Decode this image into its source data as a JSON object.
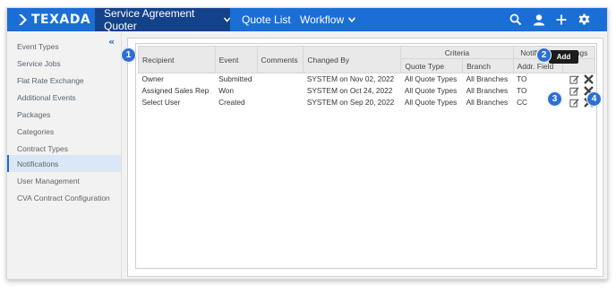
{
  "brand": {
    "name": "TEXADA",
    "bar_color": "#1b6ed6",
    "active_color": "#14428a"
  },
  "nav": {
    "active_label": "Service Agreement Quoter",
    "items": [
      "Quote List",
      "Workflow"
    ]
  },
  "top_icons": [
    "search-icon",
    "user-icon",
    "plus-icon",
    "gear-icon"
  ],
  "sidebar": {
    "collapse_label": "«",
    "items": [
      {
        "label": "Event Types"
      },
      {
        "label": "Service Jobs"
      },
      {
        "label": "Flat Rate Exchange"
      },
      {
        "label": "Additional Events"
      },
      {
        "label": "Packages"
      },
      {
        "label": "Categories"
      },
      {
        "label": "Contract Types"
      },
      {
        "label": "Notifications"
      },
      {
        "label": "User Management"
      },
      {
        "label": "CVA Contract Configuration"
      }
    ],
    "active_index": 7
  },
  "table": {
    "headers": {
      "recipient": "Recipient",
      "event": "Event",
      "comments": "Comments",
      "changed_by": "Changed By",
      "criteria": "Criteria",
      "quote_type": "Quote Type",
      "branch": "Branch",
      "notification_settings": "Notification Settings",
      "addr_field": "Addr. Field"
    },
    "rows": [
      {
        "recipient": "Owner",
        "event": "Submitted",
        "comments": "",
        "changed_by": "SYSTEM on Nov 02, 2022",
        "quote_type": "All Quote Types",
        "branch": "All Branches",
        "addr_field": "TO"
      },
      {
        "recipient": "Assigned Sales Rep",
        "event": "Won",
        "comments": "",
        "changed_by": "SYSTEM on Oct 24, 2022",
        "quote_type": "All Quote Types",
        "branch": "All Branches",
        "addr_field": "TO"
      },
      {
        "recipient": "Select User",
        "event": "Created",
        "comments": "",
        "changed_by": "SYSTEM on Sep 20, 2022",
        "quote_type": "All Quote Types",
        "branch": "All Branches",
        "addr_field": "CC"
      }
    ]
  },
  "add_button": {
    "label": "Add"
  },
  "callouts": [
    "1",
    "2",
    "3",
    "4"
  ]
}
